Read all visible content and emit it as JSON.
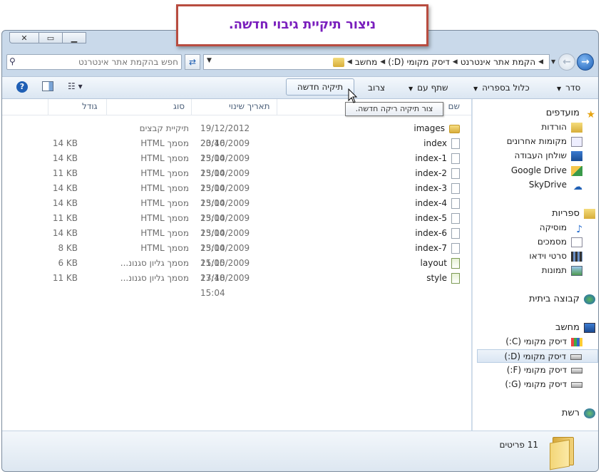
{
  "banner": {
    "text": "ניצור תיקיית גיבוי חדשה."
  },
  "window": {
    "icons": {
      "close": "close-icon",
      "maximize": "maximize-icon",
      "minimize": "minimize-icon"
    }
  },
  "address": {
    "breadcrumb": [
      "מחשב",
      "דיסק מקומי (D:)",
      "הקמת אתר אינטרנט"
    ],
    "search_placeholder": "חפש בהקמת אתר אינטרנט"
  },
  "toolbar": {
    "organize": "סדר",
    "include_in_library": "כלול בספריה",
    "share_with": "שתף עם",
    "burn": "צרוב",
    "new_folder": "תיקיה חדשה"
  },
  "tooltip": {
    "text": "צור תיקיה ריקה חדשה."
  },
  "columns": {
    "name": "שם",
    "date": "תאריך שינוי",
    "type": "סוג",
    "size": "גודל"
  },
  "files": [
    {
      "name": "images",
      "date": "19/12/2012 20:46",
      "type": "תיקיית קבצים",
      "size": "",
      "icon": "folder"
    },
    {
      "name": "index",
      "date": "23/10/2009 15:04",
      "type": "מסמך HTML",
      "size": "14 KB",
      "icon": "html"
    },
    {
      "name": "index-1",
      "date": "23/10/2009 15:04",
      "type": "מסמך HTML",
      "size": "14 KB",
      "icon": "html"
    },
    {
      "name": "index-2",
      "date": "23/10/2009 15:04",
      "type": "מסמך HTML",
      "size": "11 KB",
      "icon": "html"
    },
    {
      "name": "index-3",
      "date": "23/10/2009 15:04",
      "type": "מסמך HTML",
      "size": "14 KB",
      "icon": "html"
    },
    {
      "name": "index-4",
      "date": "23/10/2009 15:04",
      "type": "מסמך HTML",
      "size": "14 KB",
      "icon": "html"
    },
    {
      "name": "index-5",
      "date": "23/10/2009 15:04",
      "type": "מסמך HTML",
      "size": "11 KB",
      "icon": "html"
    },
    {
      "name": "index-6",
      "date": "23/10/2009 15:04",
      "type": "מסמך HTML",
      "size": "14 KB",
      "icon": "html"
    },
    {
      "name": "index-7",
      "date": "23/10/2009 15:05",
      "type": "מסמך HTML",
      "size": "8 KB",
      "icon": "html"
    },
    {
      "name": "layout",
      "date": "21/10/2009 17:48",
      "type": "מסמך גליון סגנונ...",
      "size": "6 KB",
      "icon": "css"
    },
    {
      "name": "style",
      "date": "23/10/2009 15:04",
      "type": "מסמך גליון סגנונ...",
      "size": "11 KB",
      "icon": "css"
    }
  ],
  "nav": {
    "favorites": "מועדפים",
    "favorites_items": [
      "הורדות",
      "מקומות אחרונים",
      "שולחן העבודה",
      "Google Drive",
      "SkyDrive"
    ],
    "libraries": "ספריות",
    "libraries_items": [
      "מוסיקה",
      "מסמכים",
      "סרטי וידאו",
      "תמונות"
    ],
    "homegroup": "קבוצה ביתית",
    "computer": "מחשב",
    "computer_items": [
      "דיסק מקומי (C:)",
      "דיסק מקומי (D:)",
      "דיסק מקומי (F:)",
      "דיסק מקומי (G:)"
    ],
    "network": "רשת"
  },
  "status": {
    "count": "11 פריטים"
  },
  "colors": {
    "banner_text": "#7a1fbd",
    "banner_border": "#b84c40",
    "selected_bg": "#dae6f3"
  }
}
